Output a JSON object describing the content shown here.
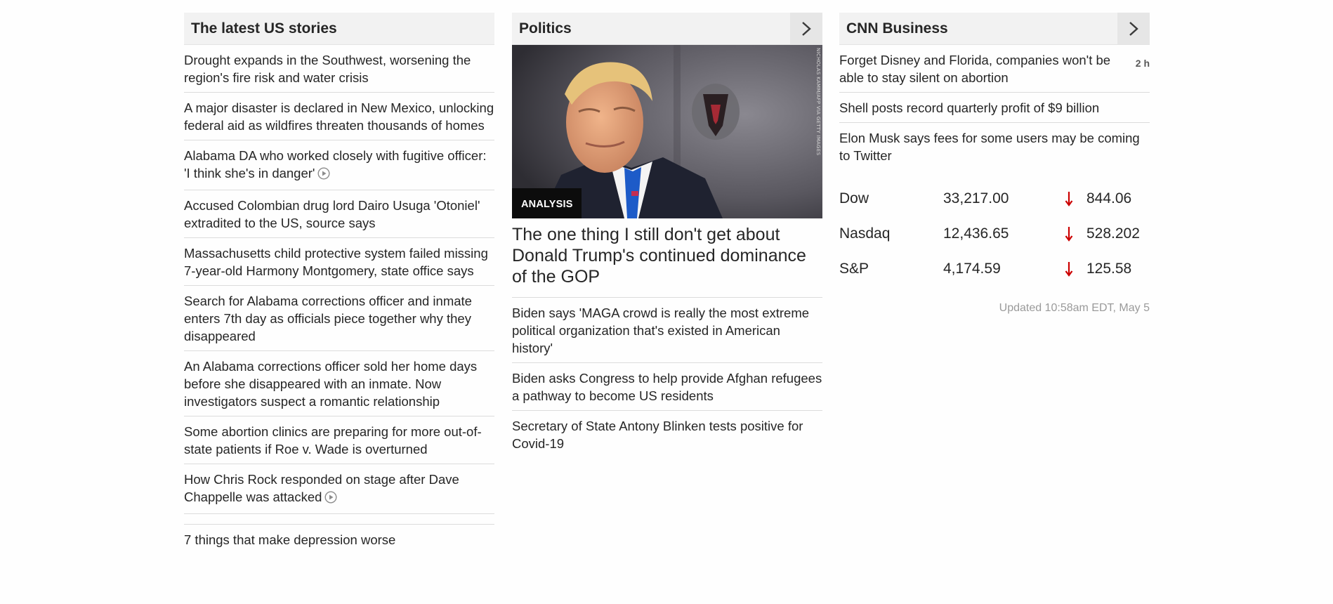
{
  "us_stories": {
    "title": "The latest US stories",
    "items": [
      {
        "text": "Drought expands in the Southwest, worsening the region's fire risk and water crisis"
      },
      {
        "text": "A major disaster is declared in New Mexico, unlocking federal aid as wildfires threaten thousands of homes"
      },
      {
        "text": "Alabama DA who worked closely with fugitive officer: 'I think she's in danger'"
      },
      {
        "text": "Accused Colombian drug lord Dairo Usuga 'Otoniel' extradited to the US, source says"
      },
      {
        "text": "Massachusetts child protective system failed missing 7-year-old Harmony Montgomery, state office says"
      },
      {
        "text": "Search for Alabama corrections officer and inmate enters 7th day as officials piece together why they disappeared"
      },
      {
        "text": "An Alabama corrections officer sold her home days before she disappeared with an inmate. Now investigators suspect a romantic relationship"
      },
      {
        "text": "Some abortion clinics are preparing for more out-of-state patients if Roe v. Wade is overturned"
      },
      {
        "text": "How Chris Rock responded on stage after Dave Chappelle was attacked"
      },
      {
        "text": "7 things that make depression worse"
      }
    ]
  },
  "politics": {
    "title": "Politics",
    "hero": {
      "image_credit": "NICHOLAS KAMM/AFP VIA GETTY IMAGES",
      "badge": "ANALYSIS",
      "headline": "The one thing I still don't get about Donald Trump's continued dominance of the GOP"
    },
    "items": [
      {
        "text": "Biden says 'MAGA crowd is really the most extreme political organization that's existed in American history'"
      },
      {
        "text": "Biden asks Congress to help provide Afghan refugees a pathway to become US residents"
      },
      {
        "text": "Secretary of State Antony Blinken tests positive for Covid-19"
      }
    ]
  },
  "business": {
    "title": "CNN Business",
    "items": [
      {
        "text": "Forget Disney and Florida, companies won't be able to stay silent on abortion",
        "time": "2 h"
      },
      {
        "text": "Shell posts record quarterly profit of $9 billion"
      },
      {
        "text": "Elon Musk says fees for some users may be coming to Twitter"
      }
    ],
    "markets": [
      {
        "name": "Dow",
        "value": "33,217.00",
        "direction": "down",
        "change": "844.06"
      },
      {
        "name": "Nasdaq",
        "value": "12,436.65",
        "direction": "down",
        "change": "528.202"
      },
      {
        "name": "S&P",
        "value": "4,174.59",
        "direction": "down",
        "change": "125.58"
      }
    ],
    "updated": "Updated 10:58am EDT, May 5"
  },
  "colors": {
    "down_arrow": "#cc0000",
    "header_bg": "#f2f2f2"
  },
  "icons": {
    "chevron": "chevron-right-icon",
    "video": "play-circle-icon",
    "market_down": "arrow-down-icon"
  }
}
